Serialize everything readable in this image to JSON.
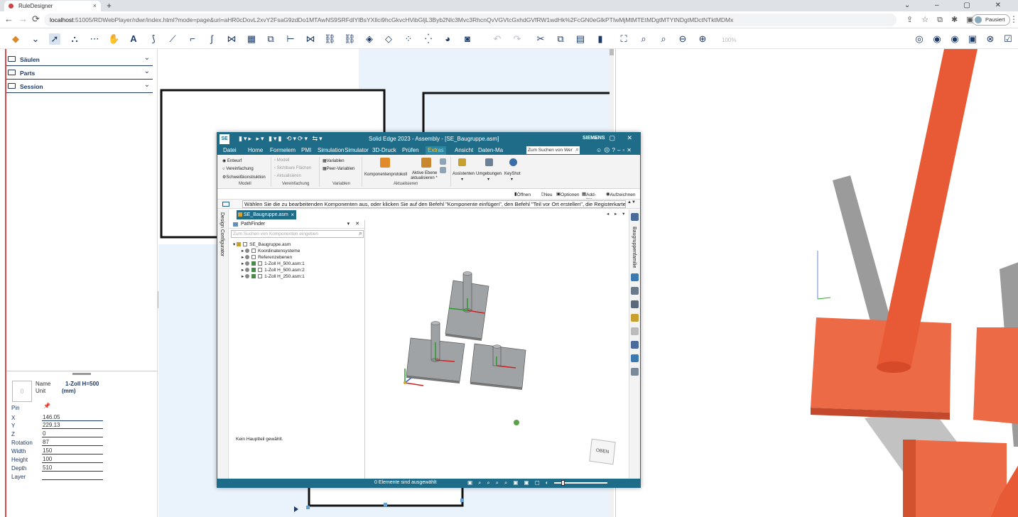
{
  "browser": {
    "tab_title": "RuleDesigner",
    "tab_close": "×",
    "new_tab": "+",
    "window_controls": "⌄ – ▢ ✕",
    "url_host": "localhost",
    "url_path": ":51005/RDWebPlayer/rdwr/index.html?mode=page&uri=aHR0cDovL2xvY2FsaG9zdDo1MTAwNS9SRFdlYlBsYXllci9hcGkvcHVibGljL3Byb2Nlc3Mvc3RhcnQvVGVtcGxhdGVfRW1wdHk%2FcGN0eGlkPTIwMjMtMTEtMDgtMTYtNDgtMDctNTktMDMx",
    "paused_label": "Pausiert",
    "back": "←",
    "forward": "→",
    "reload": "⟳",
    "menu": "⋮"
  },
  "toolbar": {
    "zoom_percent": "100%"
  },
  "left_panel": {
    "sections": [
      {
        "label": "Säulen"
      },
      {
        "label": "Parts"
      },
      {
        "label": "Session"
      }
    ],
    "chevron": "⌄"
  },
  "properties": {
    "thumb_glyph": "0",
    "name_label": "Name",
    "name_value": "1-Zoll H=500",
    "unit_label": "Unit",
    "unit_value": "(mm)",
    "pin_label": "Pin",
    "pin_icon": "📌",
    "rows": [
      {
        "label": "X",
        "value": "146.05"
      },
      {
        "label": "Y",
        "value": "229.13"
      },
      {
        "label": "Z",
        "value": "0"
      },
      {
        "label": "Rotation",
        "value": "87"
      },
      {
        "label": "Width",
        "value": "150"
      },
      {
        "label": "Height",
        "value": "100"
      },
      {
        "label": "Depth",
        "value": "510"
      },
      {
        "label": "Layer",
        "value": ""
      }
    ]
  },
  "solid_edge": {
    "logo": "SE",
    "quick_access": "▮▾▸ ▸▾ ▮▾▮ ⟲▾⟳▾ ⇆▾",
    "title": "Solid Edge 2023 - Assembly - [SE_Baugruppe.asm]",
    "brand": "SIEMENS",
    "window_buttons": "– ▢ ✕",
    "menu": [
      "Datei",
      "Home",
      "Formelem",
      "PMI",
      "Simulation",
      "Simulator",
      "3D-Druck",
      "Prüfen",
      "Extras",
      "Ansicht",
      "Daten-Ma"
    ],
    "search_placeholder": "Zum Suchen von Wer",
    "menu_right": "☺☹?‒▫✕",
    "ribbon": {
      "modell_group": "Modell",
      "entwurf": "Entwurf",
      "vereinfachung_opt": "Vereinfachung",
      "schweiss": "Schweißkonstruktion",
      "modell_item": "Modell",
      "sichtbare": "Sichtbare Flächen",
      "aktualisieren_dis": "Aktualisieren",
      "vereinfachung_group": "Vereinfachung",
      "variablen": "Variablen",
      "peer_variablen": "Peer-Variablen",
      "variablen_group": "Variablen",
      "komponentenprotokoll": "Komponentenprotokoll",
      "aktive_ebene": "Aktive Ebene",
      "aktive_ebene2": "aktualisieren *",
      "aktualisieren_group": "Aktualisieren",
      "assistenten": "Assistenten",
      "umgebungen": "Umgebungen",
      "keyshot": "KeyShot",
      "dropdown": "▾"
    },
    "commands": [
      "Öffnen",
      "Neu",
      "Optionen",
      "Add-Ins",
      "Aufzeichnen"
    ],
    "prompt": "Wählen Sie die zu bearbeitenden Komponenten aus, oder klicken Sie auf den Befehl \"Komponente einfügen\", den Befehl \"Teil vor Ort erstellen\", die Registerkarte",
    "prompt_arrows": "▲▼",
    "side_tab": "Design Configurator",
    "doc_tab": "SE_Baugruppe.asm",
    "doc_tab_close": "×",
    "tab_controls": "◂ ▸ ▾ ✕",
    "pathfinder_title": "PathFinder",
    "pathfinder_controls": "▾ ✕",
    "pathfinder_search": "Zum Suchen von Komponenten eingeben",
    "tree": [
      {
        "label": "SE_Baugruppe.asm"
      },
      {
        "label": "Koordinatensysteme"
      },
      {
        "label": "Referenzebenen"
      },
      {
        "label": "1-Zoll H_500.asm:1"
      },
      {
        "label": "1-Zoll H_500.asm:2"
      },
      {
        "label": "1-Zoll H_250.asm:1"
      }
    ],
    "no_part_msg": "Kein Hauptteil gewählt.",
    "right_tab": "Baugruppenfamilie",
    "view_cube": "OBEN",
    "status_msg": "0 Elemente sind ausgewählt",
    "status_controls": "▣ ⌕ ⌕ ⌕ ⌕ ▣ ▣ ▢ ◐"
  },
  "colors": {
    "se_teal": "#1f6c88",
    "navy": "#1d3a66",
    "orange": "#ea5b38",
    "plate_grey": "#a0a3a6"
  }
}
